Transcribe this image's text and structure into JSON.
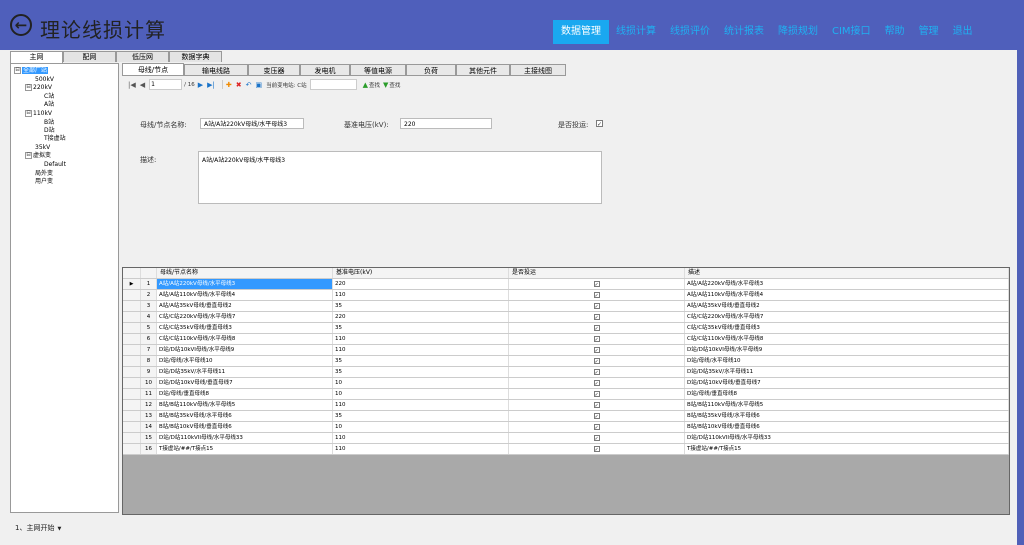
{
  "app": {
    "title": "理论线损计算",
    "nav": [
      "数据管理",
      "线损计算",
      "线损评价",
      "统计报表",
      "降损规划",
      "CIM接口",
      "帮助",
      "管理",
      "退出"
    ]
  },
  "main_tabs": [
    "主网",
    "配网",
    "低压网",
    "数据字典"
  ],
  "tree": [
    {
      "label": "全部厂站",
      "toggle": "⊟",
      "sel": true
    },
    {
      "label": "500kV",
      "toggle": ""
    },
    {
      "label": "220kV",
      "toggle": "⊟"
    },
    {
      "label": "C站",
      "toggle": ""
    },
    {
      "label": "A站",
      "toggle": ""
    },
    {
      "label": "110kV",
      "toggle": "⊟"
    },
    {
      "label": "B站",
      "toggle": ""
    },
    {
      "label": "D站",
      "toggle": ""
    },
    {
      "label": "T接虚站",
      "toggle": ""
    },
    {
      "label": "35kV",
      "toggle": ""
    },
    {
      "label": "虚拟变",
      "toggle": "⊟"
    },
    {
      "label": "Default",
      "toggle": ""
    },
    {
      "label": "局外变",
      "toggle": ""
    },
    {
      "label": "用户变",
      "toggle": ""
    }
  ],
  "sub_tabs": [
    "母线/节点",
    "输电线路",
    "变压器",
    "发电机",
    "等值电源",
    "负荷",
    "其他元件",
    "主接线图"
  ],
  "toolbar": {
    "page": "1",
    "page_total": "/ 16",
    "station_label": "当前变电站: C站",
    "find1": "查找",
    "find2": "查找",
    "icons": [
      "first-icon",
      "prev-icon",
      "next-icon",
      "last-icon",
      "add-icon",
      "delete-icon",
      "undo-icon",
      "save-icon"
    ]
  },
  "form": {
    "name_label": "母线/节点名称:",
    "name_value": "A站/A站220kV母线/水平母线3",
    "voltage_label": "基准电压(kV):",
    "voltage_value": "220",
    "run_label": "是否投运:",
    "run_checked": "✓",
    "desc_label": "描述:",
    "desc_value": "A站/A站220kV母线/水平母线3"
  },
  "grid": {
    "headers": [
      "母线/节点名称",
      "基准电压(kV)",
      "是否投运",
      "描述"
    ],
    "row_pointer": "▶",
    "rows": [
      {
        "idx": "1",
        "name": "A站/A站220kV母线/水平母线3",
        "voltage": "220",
        "run": "✓",
        "desc": "A站/A站220kV母线/水平母线3"
      },
      {
        "idx": "2",
        "name": "A站/A站110kV母线/水平母线4",
        "voltage": "110",
        "run": "✓",
        "desc": "A站/A站110kV母线/水平母线4"
      },
      {
        "idx": "3",
        "name": "A站/A站35kV母线/垂直母线2",
        "voltage": "35",
        "run": "✓",
        "desc": "A站/A站35kV母线/垂直母线2"
      },
      {
        "idx": "4",
        "name": "C站/C站220kV母线/水平母线7",
        "voltage": "220",
        "run": "✓",
        "desc": "C站/C站220kV母线/水平母线7"
      },
      {
        "idx": "5",
        "name": "C站/C站35kV母线/垂直母线3",
        "voltage": "35",
        "run": "✓",
        "desc": "C站/C站35kV母线/垂直母线3"
      },
      {
        "idx": "6",
        "name": "C站/C站110kV母线/水平母线8",
        "voltage": "110",
        "run": "✓",
        "desc": "C站/C站110kV母线/水平母线8"
      },
      {
        "idx": "7",
        "name": "D站/D站10kVI母线/水平母线9",
        "voltage": "110",
        "run": "✓",
        "desc": "D站/D站10kVI母线/水平母线9"
      },
      {
        "idx": "8",
        "name": "D站/母线/水平母线10",
        "voltage": "35",
        "run": "✓",
        "desc": "D站/母线/水平母线10"
      },
      {
        "idx": "9",
        "name": "D站/D站35kV/水平母线11",
        "voltage": "35",
        "run": "✓",
        "desc": "D站/D站35kV/水平母线11"
      },
      {
        "idx": "10",
        "name": "D站/D站10kV母线/垂直母线7",
        "voltage": "10",
        "run": "✓",
        "desc": "D站/D站10kV母线/垂直母线7"
      },
      {
        "idx": "11",
        "name": "D站/母线/垂直母线8",
        "voltage": "10",
        "run": "✓",
        "desc": "D站/母线/垂直母线8"
      },
      {
        "idx": "12",
        "name": "B站/B站110kV母线/水平母线5",
        "voltage": "110",
        "run": "✓",
        "desc": "B站/B站110kV母线/水平母线5"
      },
      {
        "idx": "13",
        "name": "B站/B站35kV母线/水平母线6",
        "voltage": "35",
        "run": "✓",
        "desc": "B站/B站35kV母线/水平母线6"
      },
      {
        "idx": "14",
        "name": "B站/B站10kV母线/垂直母线6",
        "voltage": "10",
        "run": "✓",
        "desc": "B站/B站10kV母线/垂直母线6"
      },
      {
        "idx": "15",
        "name": "D站/D站110kVII母线/水平母线33",
        "voltage": "110",
        "run": "✓",
        "desc": "D站/D站110kVII母线/水平母线33"
      },
      {
        "idx": "16",
        "name": "T接虚站/##/T接点15",
        "voltage": "110",
        "run": "✓",
        "desc": "T接虚站/##/T接点15"
      }
    ]
  },
  "status": {
    "text": "1、主网开始",
    "arrow": "▼"
  }
}
